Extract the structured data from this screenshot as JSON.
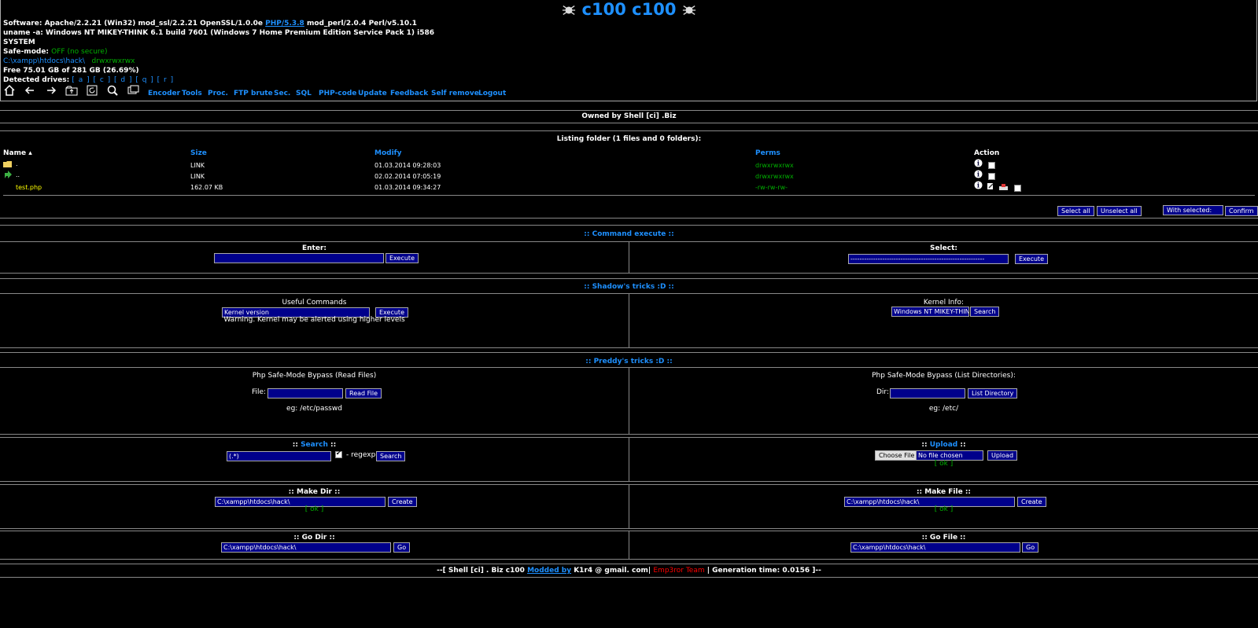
{
  "header": {
    "title": "c100 c100",
    "software_label": "Software:",
    "software_value_1": "Apache/2.2.21 (Win32) mod_ssl/2.2.21 OpenSSL/1.0.0e",
    "software_php": "PHP/5.3.8",
    "software_value_2": "mod_perl/2.0.4 Perl/v5.10.1",
    "uname": "uname -a: Windows NT MIKEY-THINK 6.1 build 7601 (Windows 7 Home Premium Edition Service Pack 1) i586",
    "user": "SYSTEM",
    "safe_mode_label": "Safe-mode:",
    "safe_mode_value": "OFF (no secure)",
    "path": "C:\\xampp\\htdocs\\hack\\",
    "path_perms": "drwxrwxrwx",
    "free_space": "Free 75.01 GB of 281 GB (26.69%)",
    "drives_label": "Detected drives:",
    "drives": "[ a ] [ c ] [ d ] [ q ] [ r ]"
  },
  "nav": {
    "links": [
      "Encoder",
      "Tools",
      "Proc.",
      "FTP brute",
      "Sec.",
      "SQL",
      "PHP-code",
      "Update",
      "Feedback",
      "Self remove",
      "Logout"
    ]
  },
  "owned_by": "Owned by Shell [ci] .Biz",
  "listing": {
    "caption": "Listing folder (1 files and 0 folders):",
    "headers": {
      "name": "Name ▴",
      "size": "Size",
      "modify": "Modify",
      "perms": "Perms",
      "action": "Action"
    },
    "rows": [
      {
        "name": ".",
        "size": "LINK",
        "modify": "01.03.2014 09:28:03",
        "perms": "drwxrwxrwx"
      },
      {
        "name": "..",
        "size": "LINK",
        "modify": "02.02.2014 07:05:19",
        "perms": "drwxrwxrwx"
      },
      {
        "name": "test.php",
        "size": "162.07 KB",
        "modify": "01.03.2014 09:34:27",
        "perms": "-rw-rw-rw-"
      }
    ],
    "select_all": "Select all",
    "unselect_all": "Unselect all",
    "with_selected": "With selected:",
    "confirm": "Confirm"
  },
  "command": {
    "title": ":: Command execute ::",
    "enter_label": "Enter:",
    "execute": "Execute",
    "select_label": "Select:",
    "select_value": "-----------------------------------------------------------"
  },
  "shadow": {
    "title": ":: Shadow's tricks :D ::",
    "useful_label": "Useful Commands",
    "useful_value": "Kernel version",
    "execute": "Execute",
    "warning": "Warning. Kernel may be alerted using higher levels",
    "kernel_label": "Kernel Info:",
    "kernel_value": "Windows NT MIKEY-THINK",
    "search": "Search"
  },
  "preddy": {
    "title": ":: Preddy's tricks :D ::",
    "read_title": "Php Safe-Mode Bypass (Read Files)",
    "file_label": "File:",
    "read_button": "Read File",
    "read_eg": "eg: /etc/passwd",
    "list_title": "Php Safe-Mode Bypass (List Directories):",
    "dir_label": "Dir:",
    "list_button": "List Directory",
    "list_eg": "eg: /etc/"
  },
  "search": {
    "title_pre": ":: ",
    "title": "Search",
    "title_post": " ::",
    "value": "(.*)",
    "regexp": "- regexp",
    "button": "Search"
  },
  "upload": {
    "title_pre": ":: ",
    "title": "Upload",
    "title_post": " ::",
    "choose": "Choose File",
    "no_file": "No file chosen",
    "button": "Upload",
    "status": "[ ok ]"
  },
  "makedir": {
    "title": ":: Make Dir ::",
    "value": "C:\\xampp\\htdocs\\hack\\",
    "button": "Create",
    "status": "[ ok ]"
  },
  "makefile": {
    "title": ":: Make File ::",
    "value": "C:\\xampp\\htdocs\\hack\\",
    "button": "Create",
    "status": "[ ok ]"
  },
  "godir": {
    "title": ":: Go Dir ::",
    "value": "C:\\xampp\\htdocs\\hack\\",
    "button": "Go"
  },
  "gofile": {
    "title": ":: Go File ::",
    "value": "C:\\xampp\\htdocs\\hack\\",
    "button": "Go"
  },
  "footer": {
    "part1": "--[ Shell [ci] . Biz c100 ",
    "modded": "Modded by",
    "part2": " K1r4 @ gmail. com| ",
    "team": "Emp3ror Team",
    "part3": " | Generation time: 0.0156 ]--"
  }
}
